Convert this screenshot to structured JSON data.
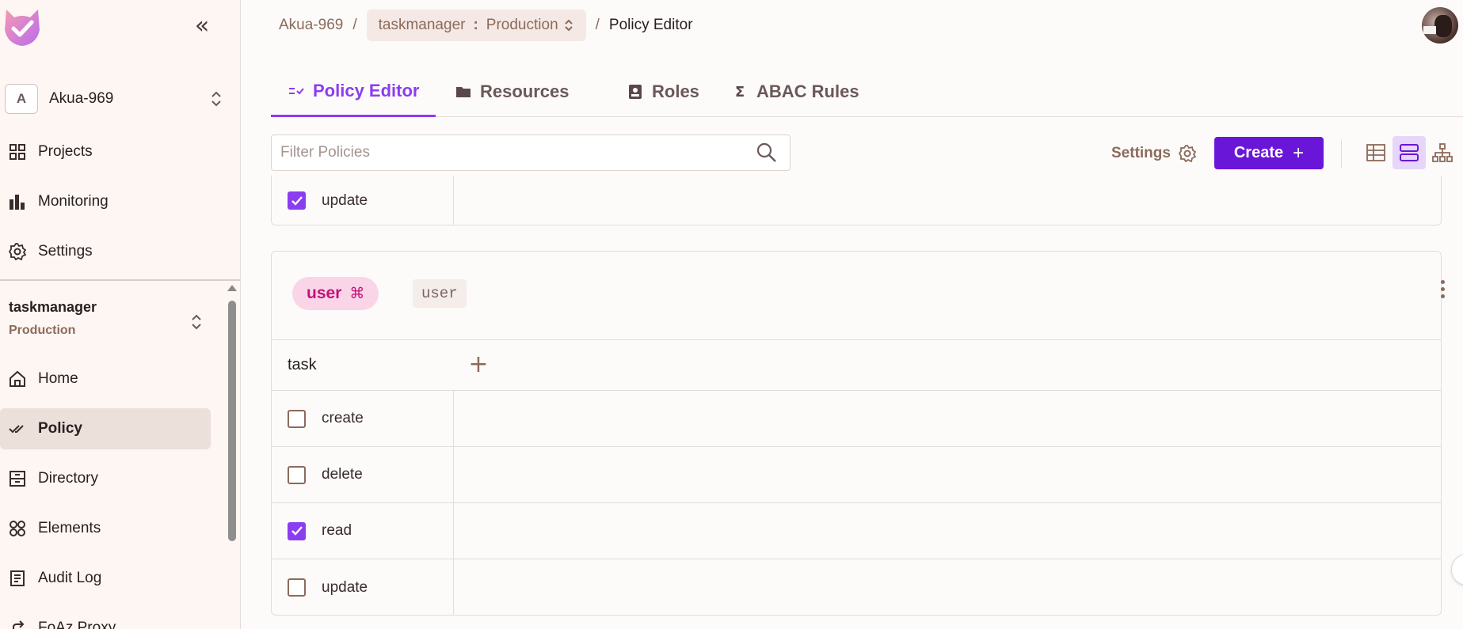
{
  "app": {
    "title": "Policy Editor",
    "accent_color": "#8b3df0",
    "brand_button_color": "#6a16d8"
  },
  "sidebar": {
    "collapse_icon": "double-chevron-left-icon",
    "org": {
      "badge": "A",
      "name": "Akua-969"
    },
    "top_items": [
      {
        "label": "Projects",
        "icon": "grid-icon"
      },
      {
        "label": "Monitoring",
        "icon": "bar-chart-icon"
      },
      {
        "label": "Settings",
        "icon": "gear-icon"
      }
    ],
    "env": {
      "project": "taskmanager",
      "environment": "Production"
    },
    "items": [
      {
        "label": "Home",
        "icon": "home-icon"
      },
      {
        "label": "Policy",
        "icon": "double-check-icon",
        "active": true
      },
      {
        "label": "Directory",
        "icon": "archive-icon"
      },
      {
        "label": "Elements",
        "icon": "circles-icon"
      },
      {
        "label": "Audit Log",
        "icon": "document-icon"
      },
      {
        "label": "FoAz Proxy",
        "icon": "share-icon"
      }
    ]
  },
  "breadcrumb": {
    "org": "Akua-969",
    "project": "taskmanager",
    "environment": "Production",
    "current": "Policy Editor"
  },
  "tabs": [
    {
      "label": "Policy Editor",
      "icon": "policy-icon",
      "active": true
    },
    {
      "label": "Resources",
      "icon": "folder-icon"
    },
    {
      "label": "Roles",
      "icon": "badge-icon"
    },
    {
      "label": "ABAC Rules",
      "icon": "sigma-icon"
    }
  ],
  "toolbar": {
    "filter_placeholder": "Filter Policies",
    "settings_label": "Settings",
    "create_label": "Create",
    "view_modes": [
      "table-view-icon",
      "rows-view-icon",
      "tree-view-icon"
    ],
    "active_view": "rows-view-icon"
  },
  "prev_card": {
    "rows": [
      {
        "action": "update",
        "checked": true
      }
    ]
  },
  "role_card": {
    "role_name": "user",
    "role_key": "user",
    "resource": "task",
    "actions": [
      {
        "action": "create",
        "checked": false
      },
      {
        "action": "delete",
        "checked": false
      },
      {
        "action": "read",
        "checked": true
      },
      {
        "action": "update",
        "checked": false
      }
    ]
  }
}
